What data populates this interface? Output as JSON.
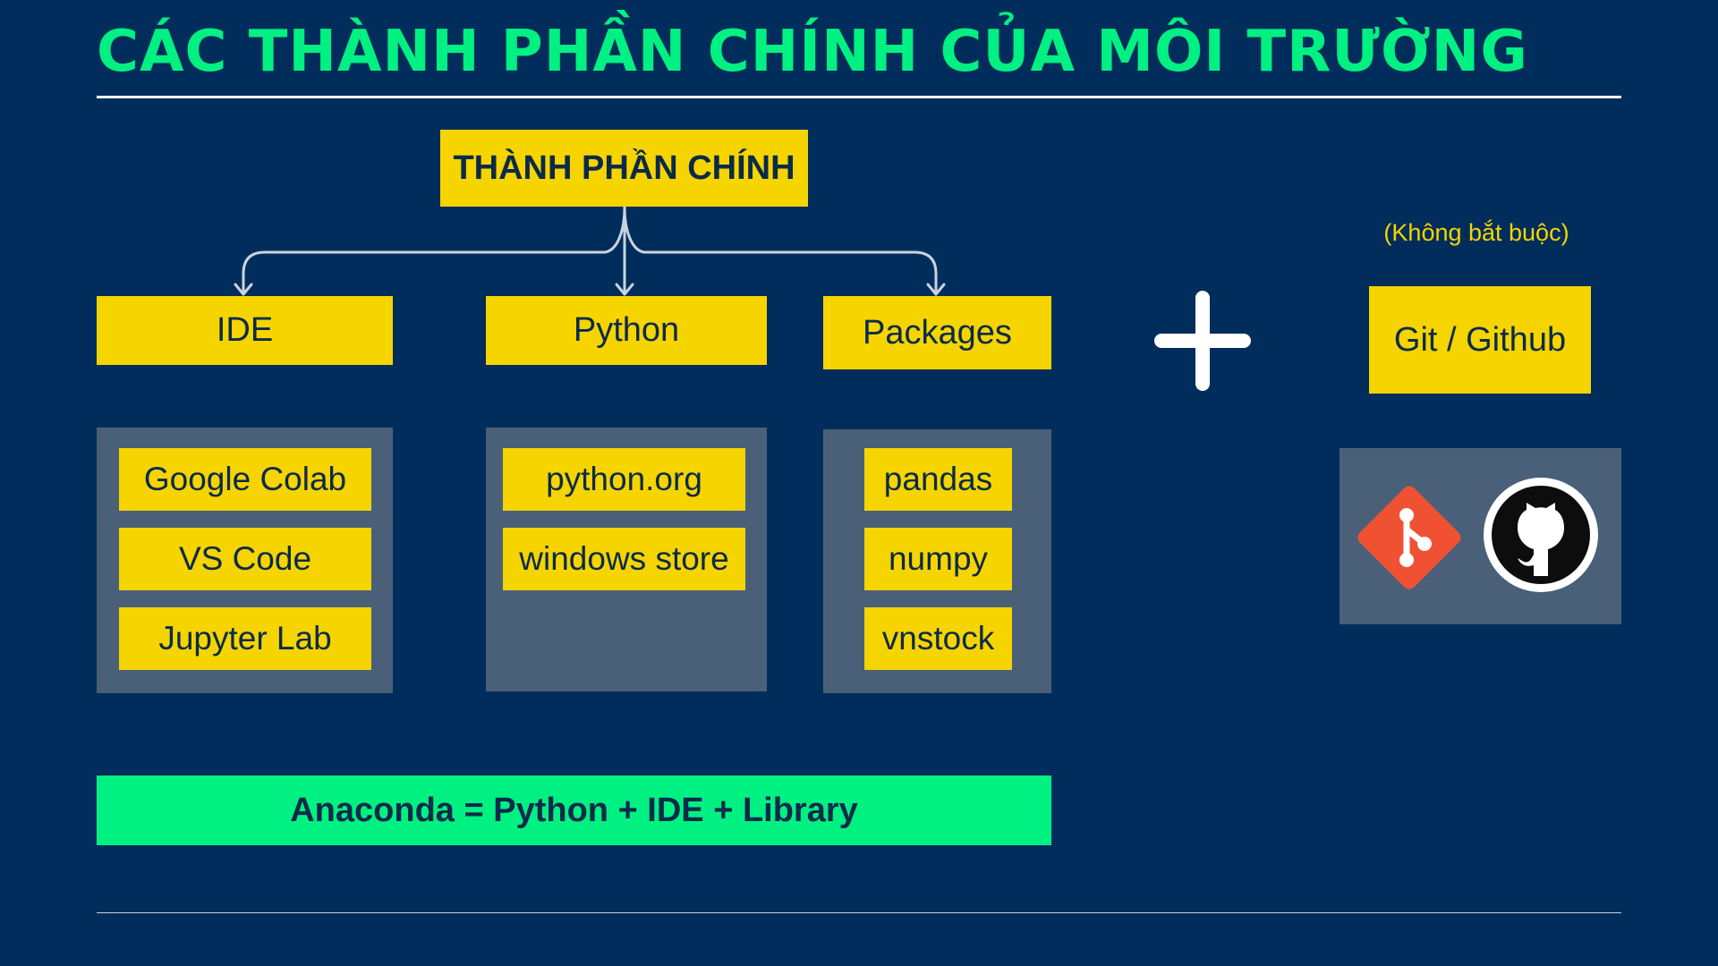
{
  "slide": {
    "title": "CÁC THÀNH PHẦN CHÍNH CỦA MÔI TRƯỜNG",
    "root_label": "THÀNH PHẦN CHÍNH",
    "categories": [
      {
        "label": "IDE",
        "items": [
          "Google Colab",
          "VS Code",
          "Jupyter Lab"
        ]
      },
      {
        "label": "Python",
        "items": [
          "python.org",
          "windows store"
        ]
      },
      {
        "label": "Packages",
        "items": [
          "pandas",
          "numpy",
          "vnstock"
        ]
      }
    ],
    "anaconda_label": "Anaconda = Python + IDE + Library",
    "optional_note": "(Không bắt buộc)",
    "git_label": "Git / Github",
    "icons": [
      "plus-icon",
      "git-logo-icon",
      "github-logo-icon"
    ]
  },
  "colors": {
    "background": "#002d5c",
    "title": "#00f082",
    "box": "#f5d400",
    "panel": "#4a6079",
    "anaconda": "#00f082",
    "git": "#f05133"
  }
}
